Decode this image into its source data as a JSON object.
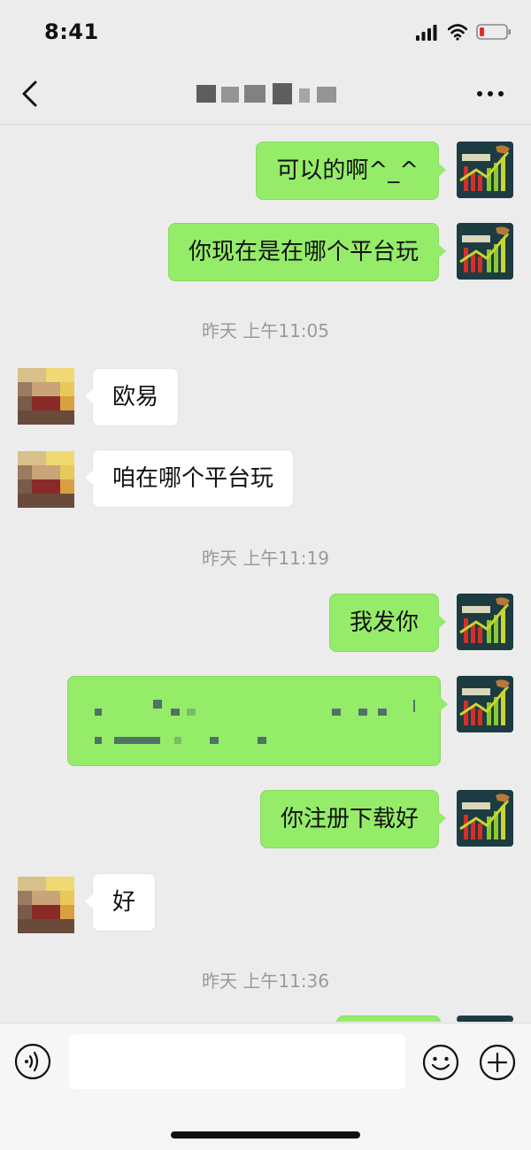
{
  "status_bar": {
    "time": "8:41"
  },
  "nav": {
    "back_icon": "chevron-left-icon",
    "more_icon": "ellipsis-icon"
  },
  "messages": [
    {
      "side": "out",
      "text": "可以的啊^_^"
    },
    {
      "side": "out",
      "text": "你现在是在哪个平台玩"
    },
    {
      "type": "time",
      "text": "昨天 上午11:05"
    },
    {
      "side": "in",
      "text": "欧易"
    },
    {
      "side": "in",
      "text": "咱在哪个平台玩"
    },
    {
      "type": "time",
      "text": "昨天 上午11:19"
    },
    {
      "side": "out",
      "text": "我发你"
    },
    {
      "side": "out",
      "type": "redacted-link"
    },
    {
      "side": "out",
      "text": "你注册下载好"
    },
    {
      "side": "in",
      "text": "好"
    },
    {
      "type": "time",
      "text": "昨天 上午11:36"
    }
  ],
  "input_bar": {
    "placeholder": "",
    "voice_icon": "voice-icon",
    "emoji_icon": "emoji-icon",
    "plus_icon": "plus-icon"
  },
  "colors": {
    "outgoing_bubble": "#95ec69",
    "incoming_bubble": "#ffffff",
    "background": "#ececec"
  }
}
